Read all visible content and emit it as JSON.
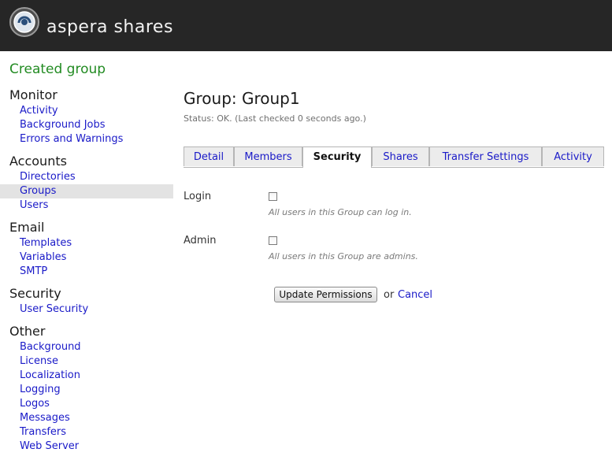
{
  "header": {
    "app_title": "aspera shares",
    "logo_icon": "aspera-logo-icon"
  },
  "flash_message": "Created group",
  "sidebar": {
    "groups": [
      {
        "heading": "Monitor",
        "items": [
          "Activity",
          "Background Jobs",
          "Errors and Warnings"
        ]
      },
      {
        "heading": "Accounts",
        "items": [
          "Directories",
          "Groups",
          "Users"
        ],
        "active": "Groups"
      },
      {
        "heading": "Email",
        "items": [
          "Templates",
          "Variables",
          "SMTP"
        ]
      },
      {
        "heading": "Security",
        "items": [
          "User Security"
        ]
      },
      {
        "heading": "Other",
        "items": [
          "Background",
          "License",
          "Localization",
          "Logging",
          "Logos",
          "Messages",
          "Transfers",
          "Web Server"
        ]
      }
    ]
  },
  "main": {
    "title": "Group: Group1",
    "status": "Status: OK. (Last checked 0 seconds ago.)",
    "tabs": [
      "Detail",
      "Members",
      "Security",
      "Shares",
      "Transfer Settings",
      "Activity"
    ],
    "active_tab": "Security",
    "permissions": [
      {
        "label": "Login",
        "checked": false,
        "hint": "All users in this Group can log in."
      },
      {
        "label": "Admin",
        "checked": false,
        "hint": "All users in this Group are admins."
      }
    ],
    "update_button": "Update Permissions",
    "or_text": "or",
    "cancel_link": "Cancel"
  },
  "colors": {
    "header_bg": "#262626",
    "flash_green": "#228b22",
    "link_blue": "#1a1ac8",
    "active_nav_bg": "#e3e3e3"
  }
}
